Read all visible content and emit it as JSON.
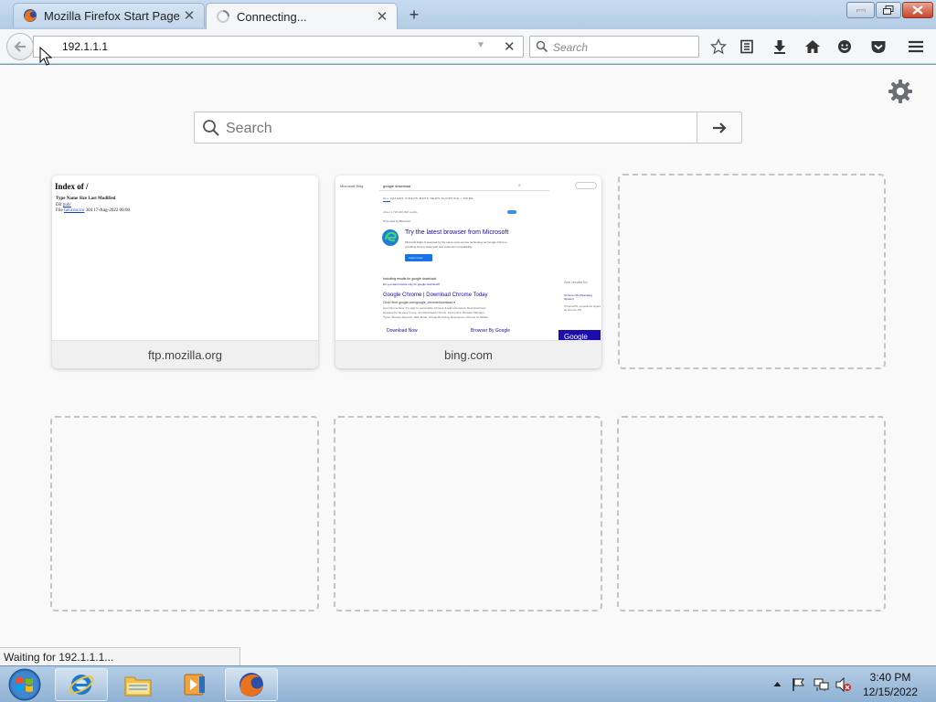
{
  "tabs": [
    {
      "label": "Mozilla Firefox Start Page",
      "icon": "firefox-icon",
      "state": "inactive"
    },
    {
      "label": "Connecting...",
      "icon": "loading-spinner-icon",
      "state": "active"
    }
  ],
  "navbar": {
    "url": "192.1.1.1",
    "search_placeholder": "Search"
  },
  "content": {
    "search_placeholder": "Search",
    "tiles": [
      {
        "caption": "ftp.mozilla.org",
        "filled": true
      },
      {
        "caption": "bing.com",
        "filled": true
      },
      {
        "caption": "",
        "filled": false
      },
      {
        "caption": "",
        "filled": false
      },
      {
        "caption": "",
        "filled": false
      },
      {
        "caption": "",
        "filled": false
      }
    ]
  },
  "ftp_thumb": {
    "title": "Index of /",
    "header_row": "Type   Name   Size   Last Modified",
    "row1_prefix": "Dir",
    "row1_link": "pub/",
    "row2_prefix": "File",
    "row2_link": "favicon.ico",
    "row2_suffix": "  304  17-Aug-2022 00:00"
  },
  "bing_thumb": {
    "brand": "Microsoft Bing",
    "query": "google download",
    "nav": "ALL    IMAGES    VIDEOS    MAPS    NEWS    SHOPPING    • MORE",
    "results_count": "About 1,720,000,000 results",
    "ad_label": "Promoted by Microsoft",
    "ad_title": "Try the latest browser from Microsoft",
    "ad_body1": "Microsoft Edge is powered by the same open-source technology as Google Chrome,",
    "ad_body2": "providing best-in-class web and extension compatibility.",
    "ad_button": "Learn more",
    "including": "Including results for google download.",
    "only": "Do you want results only for google download?",
    "see_results": "See results for",
    "result_title": "Google Chrome | Download Chrome Today",
    "result_url": "Click Here google.com/google_chrome/download ▾",
    "result_body1": "Get Chrome Now. It's easy to personalize Chrome & add extensions. Download Now.",
    "result_body2": "Designed to be easy to use. Just Download Chrome. Find online. Browser Manager.",
    "result_body3": "Types: Browse Securely, Dark Mode, Private Browsing, Extensions, Chrome on Mobile",
    "sub1": "Download Now",
    "sub2": "Browser By Google",
    "side1": "Chrome OS (Operating System)",
    "side2": "ChromeOS, sometimes styled as chrome OS",
    "google_btn": "Google"
  },
  "status": {
    "text": "Waiting for 192.1.1.1..."
  },
  "taskbar": {
    "clock_time": "3:40 PM",
    "clock_date": "12/15/2022",
    "apps": [
      "internet-explorer-icon",
      "file-explorer-icon",
      "media-player-icon",
      "firefox-icon"
    ]
  },
  "colors": {
    "accent": "#3d8fe0",
    "tile_border_dashed": "#c2c4c7",
    "taskbar": "#a3c0de"
  }
}
